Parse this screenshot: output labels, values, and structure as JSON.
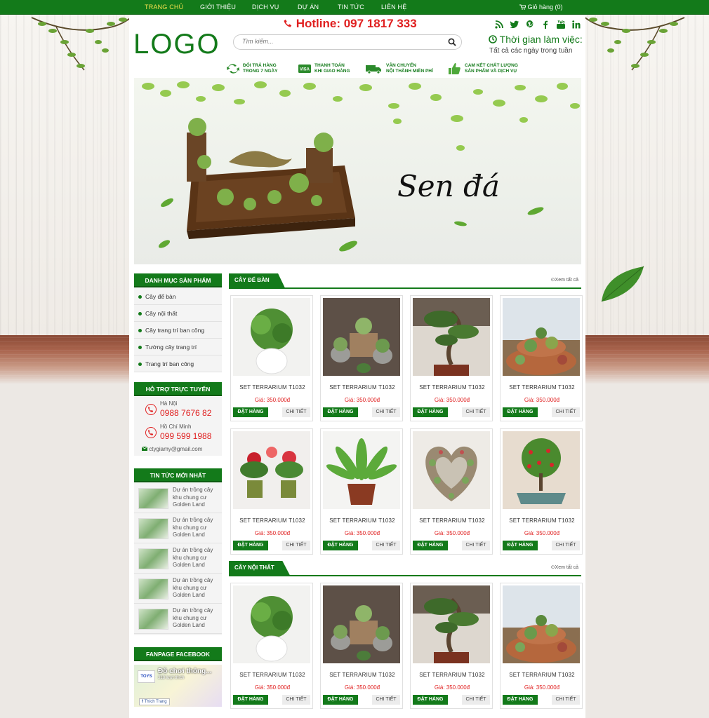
{
  "topnav": {
    "items": [
      "TRANG CHỦ",
      "GIỚI THIỆU",
      "DỊCH VỤ",
      "DỰ ÁN",
      "TIN TỨC",
      "LIÊN HỆ"
    ],
    "cart": "Giỏ hàng (0)"
  },
  "header": {
    "logo": "LOGO",
    "hotline": "Hotline: 097 1817 333",
    "search_placeholder": "Tìm kiếm...",
    "worktime_title": "Thời gian làm việc:",
    "worktime_sub": "Tất cả các ngày trong tuần",
    "socials": [
      "rss-icon",
      "twitter-icon",
      "pinterest-icon",
      "facebook-icon",
      "youtube-icon",
      "linkedin-icon"
    ]
  },
  "features": [
    {
      "line1": "ĐỔI TRẢ HÀNG",
      "line2": "TRONG 7 NGÀY",
      "icon": "refresh-icon"
    },
    {
      "line1": "THANH TOÁN",
      "line2": "KHI GIAO HÀNG",
      "icon": "visa-card-icon"
    },
    {
      "line1": "VẬN CHUYỂN",
      "line2": "NỘI THÀNH MIỄN PHÍ",
      "icon": "truck-icon"
    },
    {
      "line1": "CAM KẾT CHẤT LƯỢNG",
      "line2": "SẢN PHẨM VÀ DỊCH VỤ",
      "icon": "thumbs-up-icon"
    }
  ],
  "banner": {
    "title": "Sen đá"
  },
  "sidebar": {
    "categories_title": "DANH MỤC SẢN PHẨM",
    "categories": [
      "Cây để bàn",
      "Cây nội thất",
      "Cây trang trí ban công",
      "Tường cây trang trí",
      "Trang trí ban công"
    ],
    "support_title": "HỖ TRỢ TRỰC TUYẾN",
    "support": [
      {
        "city": "Hà Nội",
        "phone": "0988 7676 82"
      },
      {
        "city": "Hồ Chí Minh",
        "phone": "099 599 1988"
      }
    ],
    "email": "ctygiamy@gmail.com",
    "news_title": "TIN TỨC MỚI NHẤT",
    "news": [
      "Dự án trồng cây khu chung cư Golden Land",
      "Dự án trồng cây khu chung cư Golden Land",
      "Dự án trồng cây khu chung cư Golden Land",
      "Dự án trồng cây khu chung cư Golden Land",
      "Dự án trồng cây khu chung cư Golden Land"
    ],
    "fanpage_title": "FANPAGE FACEBOOK",
    "fanpage": {
      "name": "Đồ chơi thông...",
      "likes": "318 lượt thích",
      "logo": "TOYS",
      "button": "Thích Trang"
    }
  },
  "sections": [
    {
      "title": "CÂY ĐỂ BÀN",
      "more": "Xem tất cả"
    },
    {
      "title": "CÂY NỘI THẤT",
      "more": "Xem tất cả"
    }
  ],
  "product": {
    "name": "SET TERRARIUM T1032",
    "price": "Giá: 350.000đ",
    "order": "ĐẶT HÀNG",
    "detail": "CHI TIẾT"
  }
}
